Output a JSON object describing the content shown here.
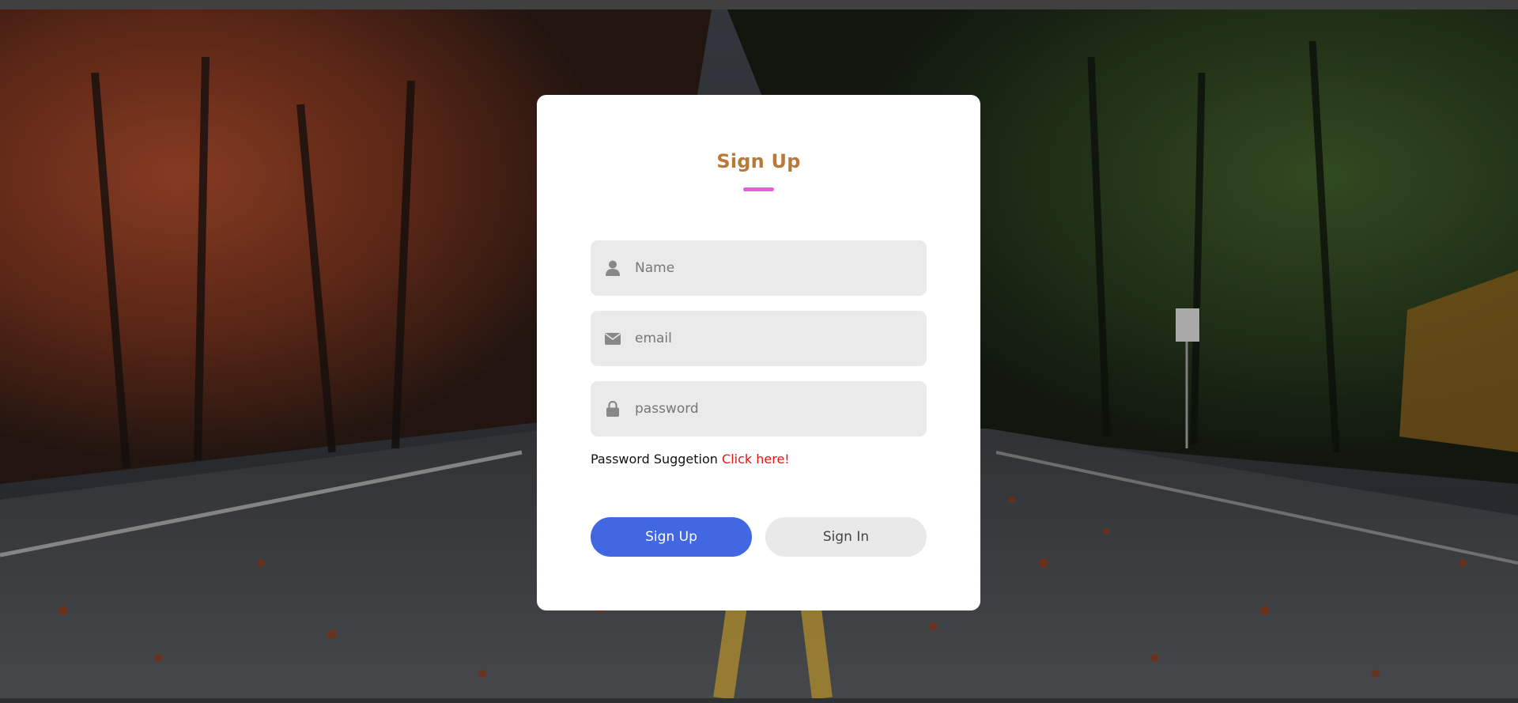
{
  "form": {
    "title": "Sign Up",
    "fields": [
      {
        "icon": "user-icon",
        "placeholder": "Name",
        "value": ""
      },
      {
        "icon": "envelope-icon",
        "placeholder": "email",
        "value": ""
      },
      {
        "icon": "lock-icon",
        "placeholder": "password",
        "value": ""
      }
    ],
    "suggestion_text": "Password Suggetion",
    "suggestion_link": "Click here!",
    "buttons": {
      "signup_label": "Sign Up",
      "signin_label": "Sign In"
    }
  },
  "colors": {
    "title": "#b8793a",
    "underline": "#e85fd0",
    "primary_button": "#4267e3",
    "secondary_button": "#e9e9e9",
    "link": "#e01616",
    "field_bg": "#eaeaea"
  }
}
